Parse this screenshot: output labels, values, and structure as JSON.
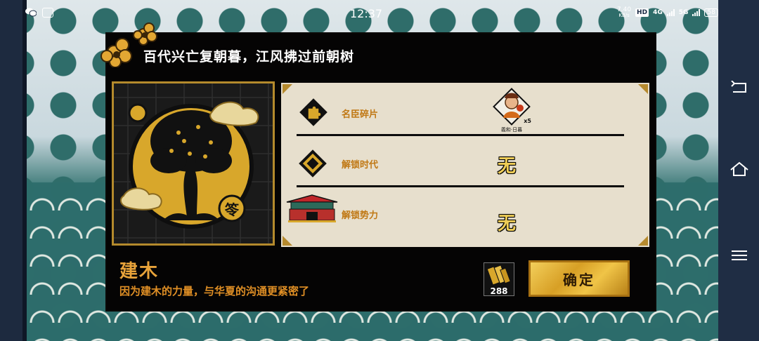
{
  "status_bar": {
    "time": "12:37",
    "speed_value": "7.40",
    "speed_unit": "KB/s",
    "hd_badge": "HD",
    "network_1": "4G",
    "network_2": "5G",
    "battery": "58"
  },
  "dialog": {
    "title": "百代兴亡复朝暮，江风拂过前朝树",
    "item_name": "建木",
    "item_description": "因为建木的力量，与华夏的沟通更紧密了",
    "cost_count": "288",
    "confirm_label": "确定",
    "portrait_seal": "笭",
    "rows": [
      {
        "label": "名臣碎片",
        "icon": "puzzle-piece-icon",
        "reward_name": "義和·日暮",
        "reward_qty": "x5"
      },
      {
        "label": "解锁时代",
        "icon": "diamond-emblem-icon",
        "value": "无"
      },
      {
        "label": "解锁势力",
        "icon": "palace-gate-icon",
        "value": "无"
      }
    ]
  },
  "colors": {
    "gold": "#e8a33a",
    "panel_bg": "#e7dfcd",
    "dialog_bg": "#050404",
    "confirm_gold": "#f0c447"
  }
}
